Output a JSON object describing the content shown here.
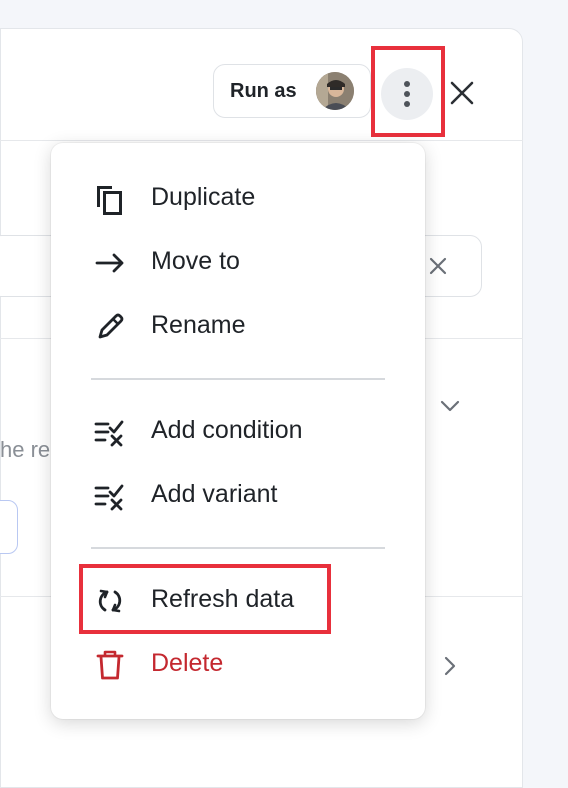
{
  "header": {
    "run_as_label": "Run as",
    "more_icon": "more-vertical-icon",
    "close_icon": "close-icon"
  },
  "background": {
    "text_fragment": "he re"
  },
  "menu": {
    "items": [
      {
        "label": "Duplicate",
        "icon": "duplicate-icon"
      },
      {
        "label": "Move to",
        "icon": "arrow-right-icon"
      },
      {
        "label": "Rename",
        "icon": "pencil-icon"
      },
      {
        "label": "Add condition",
        "icon": "condition-icon"
      },
      {
        "label": "Add variant",
        "icon": "variant-icon"
      },
      {
        "label": "Refresh data",
        "icon": "refresh-icon"
      },
      {
        "label": "Delete",
        "icon": "trash-icon"
      }
    ]
  },
  "colors": {
    "highlight": "#e8303c",
    "danger": "#c4282f"
  }
}
